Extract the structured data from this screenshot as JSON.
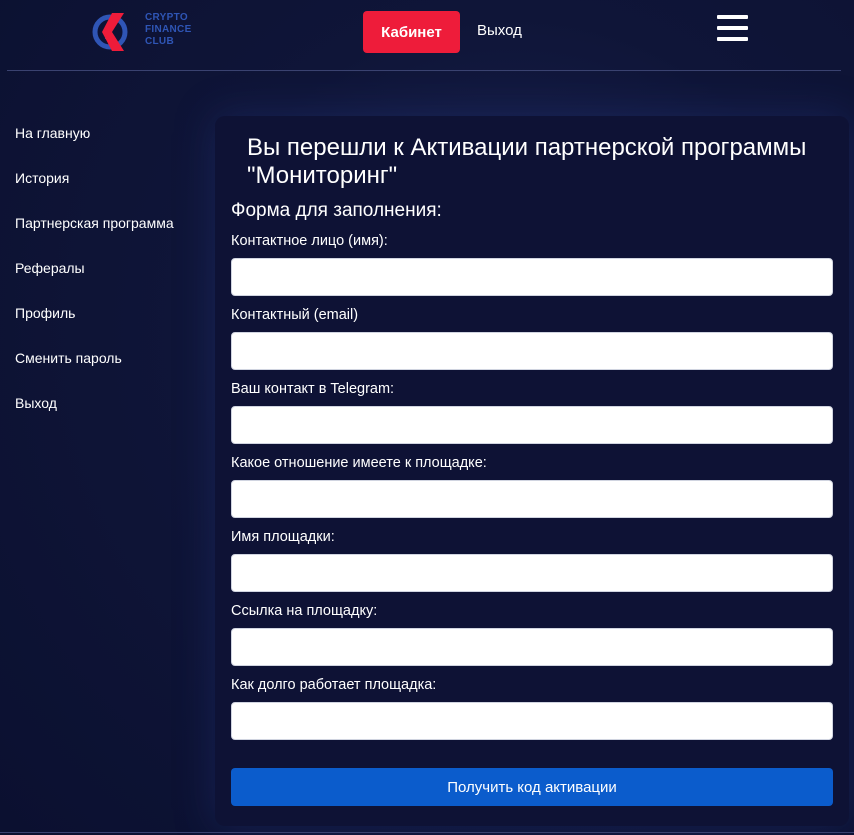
{
  "header": {
    "logo_lines": [
      "CRYPTO",
      "FINANCE",
      "CLUB"
    ],
    "cabinet_label": "Кабинет",
    "exit_label": "Выход",
    "menu_icon": "hamburger-icon"
  },
  "sidebar": {
    "items": [
      {
        "label": "На главную"
      },
      {
        "label": "История"
      },
      {
        "label": "Партнерская программа"
      },
      {
        "label": "Рефералы"
      },
      {
        "label": "Профиль"
      },
      {
        "label": "Сменить пароль"
      },
      {
        "label": "Выход"
      }
    ]
  },
  "main": {
    "title": "Вы перешли к Активации партнерской программы \"Мониторинг\"",
    "form_heading": "Форма для заполнения:",
    "fields": [
      {
        "label": "Контактное лицо (имя):",
        "value": ""
      },
      {
        "label": "Контактный (email)",
        "value": ""
      },
      {
        "label": "Ваш контакт в Telegram:",
        "value": ""
      },
      {
        "label": "Какое отношение имеете к площадке:",
        "value": ""
      },
      {
        "label": "Имя площадки:",
        "value": ""
      },
      {
        "label": "Ссылка на площадку:",
        "value": ""
      },
      {
        "label": "Как долго работает площадка:",
        "value": ""
      }
    ],
    "submit_label": "Получить код активации"
  },
  "colors": {
    "background": "#0c1133",
    "panel": "#0e1235",
    "accent_red": "#ee1c3a",
    "accent_blue": "#0b5ccc",
    "logo_blue": "#2f55b5"
  }
}
